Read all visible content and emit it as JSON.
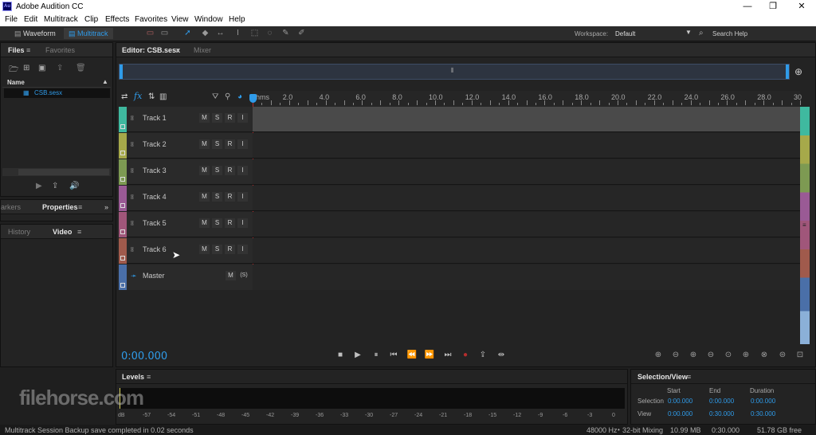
{
  "window": {
    "title": "Adobe Audition CC",
    "app_icon": "Au"
  },
  "menu": [
    "File",
    "Edit",
    "Multitrack",
    "Clip",
    "Effects",
    "Favorites",
    "View",
    "Window",
    "Help"
  ],
  "toolbar": {
    "waveform": "Waveform",
    "multitrack": "Multitrack",
    "workspace_label": "Workspace:",
    "workspace_value": "Default",
    "search_help": "Search Help"
  },
  "files_panel": {
    "tab_files": "Files",
    "tab_favorites": "Favorites",
    "col_name": "Name",
    "items": [
      "CSB.sesx"
    ]
  },
  "markers_panel": {
    "tab_markers": "arkers",
    "tab_properties": "Properties"
  },
  "history_panel": {
    "tab_history": "History",
    "tab_video": "Video"
  },
  "editor": {
    "tab_editor": "Editor: CSB.sesx",
    "tab_mixer": "Mixer"
  },
  "ruler": {
    "unit": "hms",
    "labels": [
      "2.0",
      "4.0",
      "6.0",
      "8.0",
      "10.0",
      "12.0",
      "14.0",
      "16.0",
      "18.0",
      "20.0",
      "22.0",
      "24.0",
      "26.0",
      "28.0",
      "30"
    ]
  },
  "tracks": [
    {
      "name": "Track 1",
      "color": "#3fb99f",
      "buttons": [
        "M",
        "S",
        "R",
        "I"
      ]
    },
    {
      "name": "Track 2",
      "color": "#a6a94a",
      "buttons": [
        "M",
        "S",
        "R",
        "I"
      ]
    },
    {
      "name": "Track 3",
      "color": "#7d9a52",
      "buttons": [
        "M",
        "S",
        "R",
        "I"
      ]
    },
    {
      "name": "Track 4",
      "color": "#9a5a95",
      "buttons": [
        "M",
        "S",
        "R",
        "I"
      ]
    },
    {
      "name": "Track 5",
      "color": "#a0567a",
      "buttons": [
        "M",
        "S",
        "R",
        "I"
      ]
    },
    {
      "name": "Track 6",
      "color": "#a05a4c",
      "buttons": [
        "M",
        "S",
        "R",
        "I"
      ]
    }
  ],
  "master": {
    "name": "Master",
    "m": "M",
    "s": "(S)",
    "color": "#4a6fa8"
  },
  "time_display": "0:00.000",
  "levels": {
    "title": "Levels",
    "labels": [
      "dB",
      "-57",
      "-54",
      "-51",
      "-48",
      "-45",
      "-42",
      "-39",
      "-36",
      "-33",
      "-30",
      "-27",
      "-24",
      "-21",
      "-18",
      "-15",
      "-12",
      "-9",
      "-6",
      "-3",
      "0"
    ]
  },
  "selection_view": {
    "title": "Selection/View",
    "headers": [
      "Start",
      "End",
      "Duration"
    ],
    "rows": [
      {
        "label": "Selection",
        "start": "0:00.000",
        "end": "0:00.000",
        "duration": "0:00.000"
      },
      {
        "label": "View",
        "start": "0:00.000",
        "end": "0:30.000",
        "duration": "0:30.000"
      }
    ]
  },
  "status": {
    "message": "Multitrack Session Backup save completed in 0.02 seconds",
    "sample_rate": "48000 Hz",
    "bit_depth": "32-bit Mixing",
    "size": "10.99 MB",
    "duration": "0:30.000",
    "free": "51.78 GB free"
  },
  "watermark": "filehorse.com"
}
